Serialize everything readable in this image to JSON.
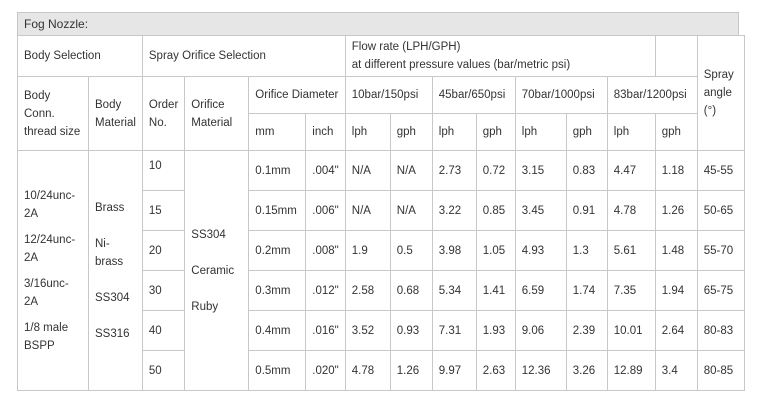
{
  "title": "Fog Nozzle:",
  "headers": {
    "body_selection": "Body Selection",
    "spray_orifice_selection": "Spray Orifice Selection",
    "flow_rate_line1": "Flow rate (LPH/GPH)",
    "flow_rate_line2": "at different pressure values (bar/metric psi)",
    "spray_angle": "Spray angle (°)",
    "body_conn": "Body Conn. thread size",
    "body_material": "Body Material",
    "order_no": "Order No.",
    "orifice_material": "Orifice Material",
    "orifice_diameter": "Orifice Diameter",
    "p1": "10bar/150psi",
    "p2": "45bar/650psi",
    "p3": "70bar/1000psi",
    "p4": "83bar/1200psi",
    "mm": "mm",
    "inch": "inch",
    "lph": "lph",
    "gph": "gph"
  },
  "body_conn_values": [
    "10/24unc-2A",
    "12/24unc-2A",
    "3/16unc-2A",
    "1/8 male BSPP"
  ],
  "body_material_values": [
    "Brass",
    "Ni-brass",
    "SS304",
    "SS316"
  ],
  "orifice_material_values": [
    "SS304",
    "Ceramic",
    "Ruby"
  ],
  "rows": [
    {
      "order": "10",
      "mm": "0.1mm",
      "inch": ".004\"",
      "p1_lph": "N/A",
      "p1_gph": "N/A",
      "p2_lph": "2.73",
      "p2_gph": "0.72",
      "p3_lph": "3.15",
      "p3_gph": "0.83",
      "p4_lph": "4.47",
      "p4_gph": "1.18",
      "angle": "45-55"
    },
    {
      "order": "15",
      "mm": "0.15mm",
      "inch": ".006\"",
      "p1_lph": "N/A",
      "p1_gph": "N/A",
      "p2_lph": "3.22",
      "p2_gph": "0.85",
      "p3_lph": "3.45",
      "p3_gph": "0.91",
      "p4_lph": "4.78",
      "p4_gph": "1.26",
      "angle": "50-65"
    },
    {
      "order": "20",
      "mm": "0.2mm",
      "inch": ".008\"",
      "p1_lph": "1.9",
      "p1_gph": "0.5",
      "p2_lph": "3.98",
      "p2_gph": "1.05",
      "p3_lph": "4.93",
      "p3_gph": "1.3",
      "p4_lph": "5.61",
      "p4_gph": "1.48",
      "angle": "55-70"
    },
    {
      "order": "30",
      "mm": "0.3mm",
      "inch": ".012\"",
      "p1_lph": "2.58",
      "p1_gph": "0.68",
      "p2_lph": "5.34",
      "p2_gph": "1.41",
      "p3_lph": "6.59",
      "p3_gph": "1.74",
      "p4_lph": "7.35",
      "p4_gph": "1.94",
      "angle": "65-75"
    },
    {
      "order": "40",
      "mm": "0.4mm",
      "inch": ".016\"",
      "p1_lph": "3.52",
      "p1_gph": "0.93",
      "p2_lph": "7.31",
      "p2_gph": "1.93",
      "p3_lph": "9.06",
      "p3_gph": "2.39",
      "p4_lph": "10.01",
      "p4_gph": "2.64",
      "angle": "80-83"
    },
    {
      "order": "50",
      "mm": "0.5mm",
      "inch": ".020\"",
      "p1_lph": "4.78",
      "p1_gph": "1.26",
      "p2_lph": "9.97",
      "p2_gph": "2.63",
      "p3_lph": "12.36",
      "p3_gph": "3.26",
      "p4_lph": "12.89",
      "p4_gph": "3.4",
      "angle": "80-85"
    }
  ]
}
